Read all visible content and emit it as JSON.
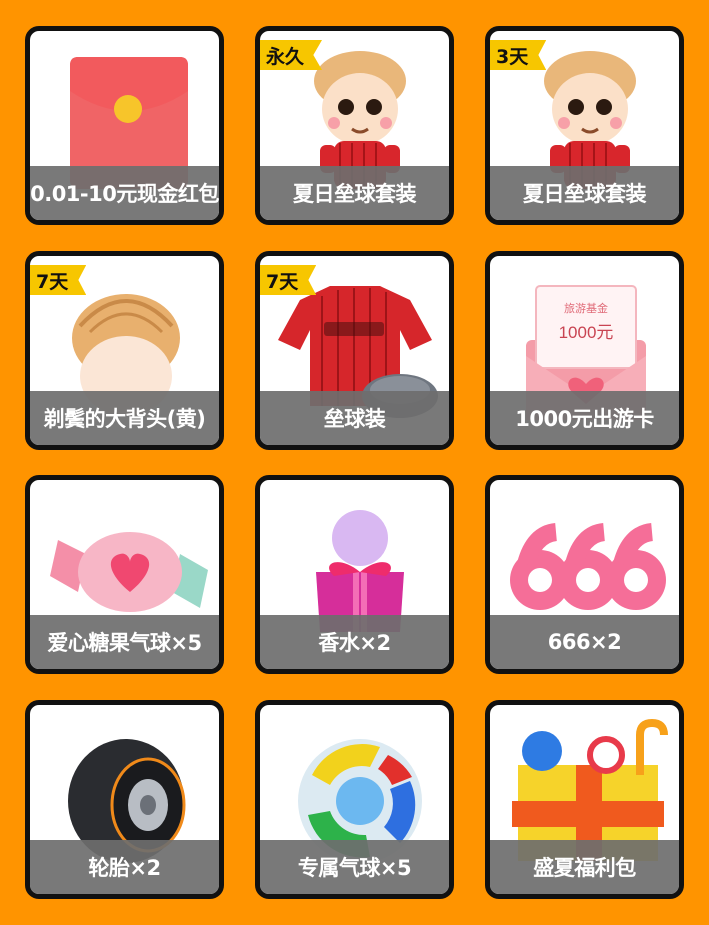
{
  "colors": {
    "background": "#FF9400",
    "badge": "#F7C600",
    "label_bar": "#6E6E6E"
  },
  "items": [
    {
      "label": "0.01-10元现金红包",
      "badge": "",
      "icon": "red-envelope-icon"
    },
    {
      "label": "夏日垒球套装",
      "badge": "永久",
      "icon": "baseball-character-icon"
    },
    {
      "label": "夏日垒球套装",
      "badge": "3天",
      "icon": "baseball-character-icon"
    },
    {
      "label": "剃鬓的大背头(黄)",
      "badge": "7天",
      "icon": "hairstyle-head-icon"
    },
    {
      "label": "垒球装",
      "badge": "7天",
      "icon": "baseball-jersey-icon"
    },
    {
      "label": "1000元出游卡",
      "badge": "",
      "icon": "travel-card-envelope-icon",
      "card_title": "旅游基金",
      "card_amount": "1000元"
    },
    {
      "label": "爱心糖果气球×5",
      "badge": "",
      "icon": "heart-candy-icon"
    },
    {
      "label": "香水×2",
      "badge": "",
      "icon": "perfume-gift-icon"
    },
    {
      "label": "666×2",
      "badge": "",
      "icon": "number-666-icon"
    },
    {
      "label": "轮胎×2",
      "badge": "",
      "icon": "tire-icon"
    },
    {
      "label": "专属气球×5",
      "badge": "",
      "icon": "qq-balloon-icon"
    },
    {
      "label": "盛夏福利包",
      "badge": "",
      "icon": "gift-box-icon"
    }
  ]
}
